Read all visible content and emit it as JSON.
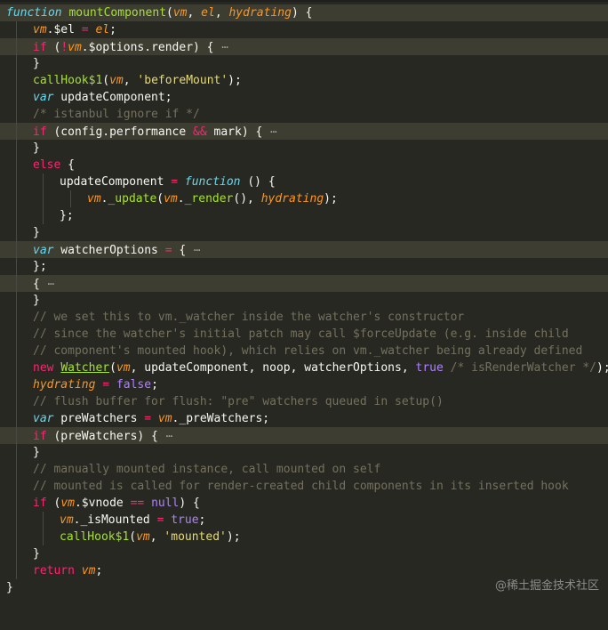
{
  "editor": {
    "theme_colors": {
      "background": "#272822",
      "keyword": "#f92672",
      "storage": "#66d9ef",
      "function": "#a6e22e",
      "parameter": "#fd971f",
      "string": "#e6db74",
      "comment": "#75715e",
      "constant": "#ae81ff"
    },
    "fold_marker": "⋯",
    "lines": [
      "function mountComponent(vm, el, hydrating) {",
      "vm.$el = el;",
      "if (!vm.$options.render) {",
      "}",
      "callHook$1(vm, 'beforeMount');",
      "var updateComponent;",
      "/* istanbul ignore if */",
      "if (config.performance && mark) {",
      "}",
      "else {",
      "updateComponent = function () {",
      "vm._update(vm._render(), hydrating);",
      "};",
      "}",
      "var watcherOptions = {",
      "};",
      "{",
      "}",
      "// we set this to vm._watcher inside the watcher's constructor",
      "// since the watcher's initial patch may call $forceUpdate (e.g. inside child",
      "// component's mounted hook), which relies on vm._watcher being already defined",
      "new Watcher(vm, updateComponent, noop, watcherOptions, true /* isRenderWatcher */);",
      "hydrating = false;",
      "// flush buffer for flush: \"pre\" watchers queued in setup()",
      "var preWatchers = vm._preWatchers;",
      "if (preWatchers) {",
      "}",
      "// manually mounted instance, call mounted on self",
      "// mounted is called for render-created child components in its inserted hook",
      "if (vm.$vnode == null) {",
      "vm._isMounted = true;",
      "callHook$1(vm, 'mounted');",
      "}",
      "return vm;",
      "}"
    ]
  },
  "watermark": "@稀土掘金技术社区"
}
